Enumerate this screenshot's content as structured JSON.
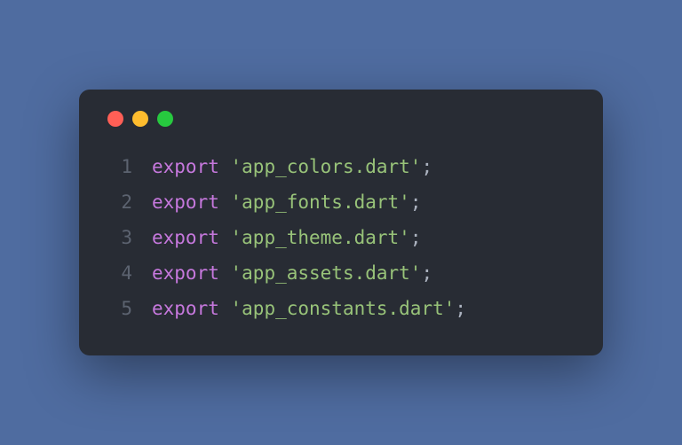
{
  "code": {
    "lines": [
      {
        "num": "1",
        "keyword": "export",
        "string": "'app_colors.dart'",
        "punct": ";"
      },
      {
        "num": "2",
        "keyword": "export",
        "string": "'app_fonts.dart'",
        "punct": ";"
      },
      {
        "num": "3",
        "keyword": "export",
        "string": "'app_theme.dart'",
        "punct": ";"
      },
      {
        "num": "4",
        "keyword": "export",
        "string": "'app_assets.dart'",
        "punct": ";"
      },
      {
        "num": "5",
        "keyword": "export",
        "string": "'app_constants.dart'",
        "punct": ";"
      }
    ]
  }
}
